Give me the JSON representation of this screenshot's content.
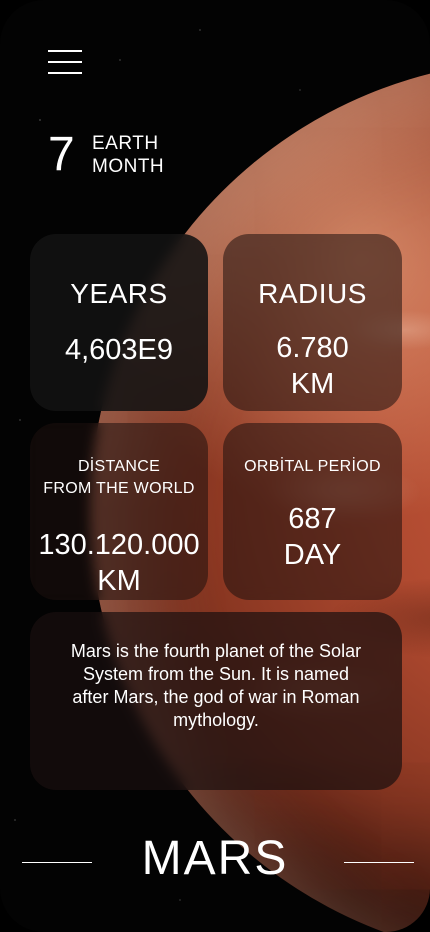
{
  "header": {
    "menu_icon": "hamburger-menu-icon"
  },
  "period": {
    "value": "7",
    "unit_line1": "EARTH",
    "unit_line2": "MONTH"
  },
  "cards": {
    "years": {
      "title": "YEARS",
      "value": "4,603E9"
    },
    "radius": {
      "title": "RADIUS",
      "value_line1": "6.780",
      "value_line2": "KM"
    },
    "distance": {
      "title_line1": "DİSTANCE",
      "title_line2": "FROM THE WORLD",
      "value_line1": "130.120.000",
      "value_line2": "KM"
    },
    "orbital": {
      "title": "ORBİTAL PERİOD",
      "value_line1": "687",
      "value_line2": "DAY"
    }
  },
  "description": "Mars is the fourth planet of the Solar System from the Sun. It is named after Mars, the god of war in Roman mythology.",
  "planet": {
    "name": "MARS"
  },
  "colors": {
    "background": "#030303",
    "planet": "#b04a30",
    "card": "#1e100e"
  }
}
